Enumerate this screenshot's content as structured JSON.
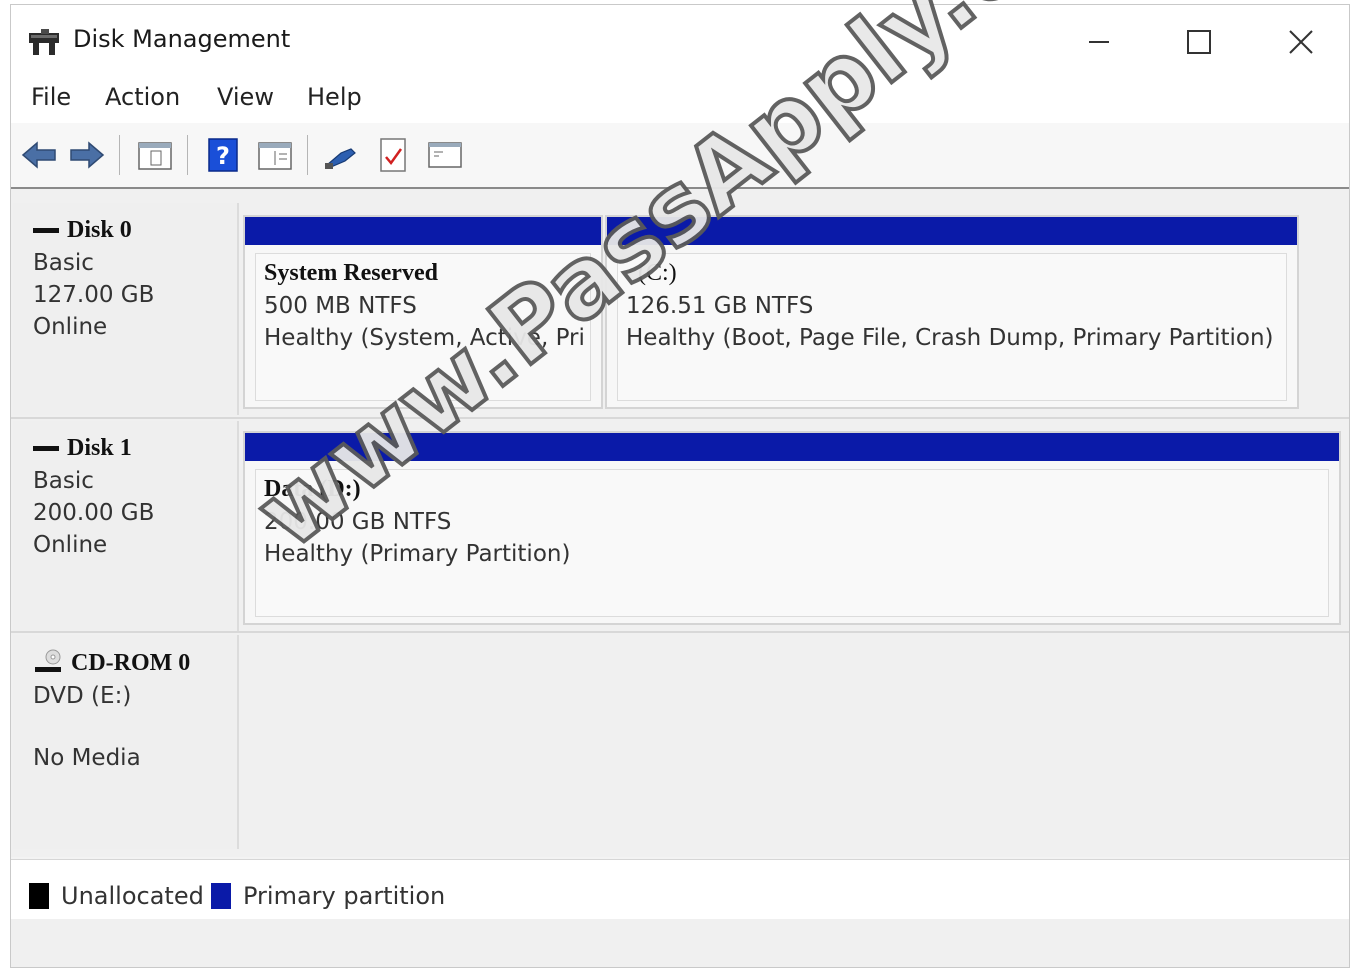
{
  "window": {
    "title": "Disk Management",
    "minimize": "—",
    "maximize": "☐",
    "close": "✕"
  },
  "menu": [
    "File",
    "Action",
    "View",
    "Help"
  ],
  "toolbar": {
    "icons": [
      "back-arrow-icon",
      "forward-arrow-icon",
      "console-tree-icon",
      "help-icon",
      "properties-icon",
      "connect-icon",
      "check-doc-icon",
      "window-icon"
    ]
  },
  "disks": [
    {
      "name": "Disk 0",
      "type": "Basic",
      "size": "127.00 GB",
      "status": "Online",
      "partitions": [
        {
          "title": "System Reserved",
          "size": "500 MB NTFS",
          "health": "Healthy (System, Active, Pri"
        },
        {
          "title": "(C:)",
          "size": "126.51 GB NTFS",
          "health": "Healthy (Boot, Page File, Crash Dump, Primary Partition)"
        }
      ]
    },
    {
      "name": "Disk 1",
      "type": "Basic",
      "size": "200.00 GB",
      "status": "Online",
      "partitions": [
        {
          "title": "Data  (D:)",
          "size": "200.00 GB NTFS",
          "health": "Healthy (Primary Partition)"
        }
      ]
    },
    {
      "name": "CD-ROM 0",
      "type": "DVD (E:)",
      "status": "No Media"
    }
  ],
  "legend": [
    {
      "label": "Unallocated",
      "color": "#000000"
    },
    {
      "label": "Primary partition",
      "color": "#0a1aa8"
    }
  ],
  "watermark": "www.PassApply.com"
}
